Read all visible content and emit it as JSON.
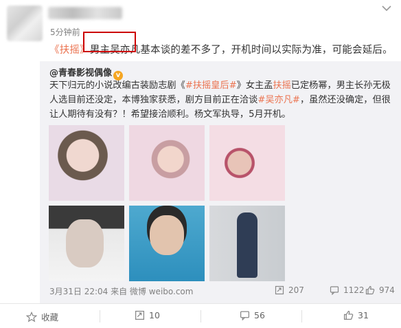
{
  "post": {
    "time": "5分钟前",
    "text_open_quote": "《",
    "text_title": "扶摇",
    "text_close_quote": "》",
    "text_highlight": "男主吴亦凡",
    "text_rest": "基本谈的差不多了，开机时间以实际为准，可能会延后。"
  },
  "repost": {
    "user": "@青春影视偶像",
    "verified_badge": "v",
    "text": {
      "a": "天下归元的小说改编古装励志剧《",
      "tag1": "#扶摇皇后#",
      "b": "》女主孟",
      "hl1": "扶摇",
      "c": "已定杨幂，男主长孙无极人选目前还没定，本博独家获悉，剧方目前正在洽谈",
      "tag2": "#吴亦凡#",
      "d": "，虽然还没确定，但很让人期待有没有？！希望接洽顺利。杨文军执导，5月开机。"
    },
    "meta": "3月31日 22:04 来自 微博 weibo.com",
    "reposts": "207",
    "comments": "1122",
    "likes": "974"
  },
  "actions": {
    "collect": "收藏",
    "repost": "10",
    "comment": "56",
    "like": "31"
  },
  "colors": {
    "accent": "#eb7350",
    "box": "#cc0000",
    "repost_bg": "#f2f2f5"
  },
  "icons": [
    "chevron-down-icon",
    "verified-icon",
    "repost-icon",
    "comment-icon",
    "like-icon",
    "star-icon"
  ]
}
